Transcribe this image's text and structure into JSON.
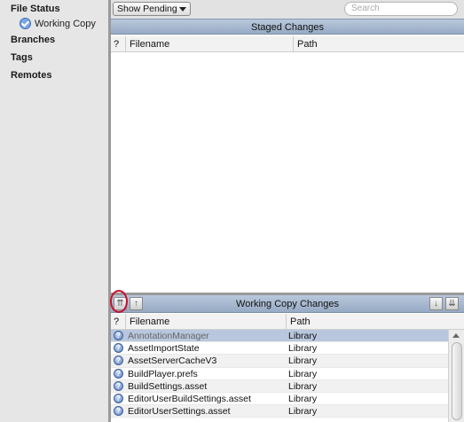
{
  "sidebar": {
    "file_status": "File Status",
    "working_copy": "Working Copy",
    "branches": "Branches",
    "tags": "Tags",
    "remotes": "Remotes"
  },
  "toolbar": {
    "filter_value": "Show Pending",
    "search_placeholder": "Search"
  },
  "staged": {
    "title": "Staged Changes",
    "col_status": "?",
    "col_filename": "Filename",
    "col_path": "Path"
  },
  "working": {
    "title": "Working Copy Changes",
    "col_status": "?",
    "col_filename": "Filename",
    "col_path": "Path",
    "rows": [
      {
        "filename": "AnnotationManager",
        "path": "Library"
      },
      {
        "filename": "AssetImportState",
        "path": "Library"
      },
      {
        "filename": "AssetServerCacheV3",
        "path": "Library"
      },
      {
        "filename": "BuildPlayer.prefs",
        "path": "Library"
      },
      {
        "filename": "BuildSettings.asset",
        "path": "Library"
      },
      {
        "filename": "EditorUserBuildSettings.asset",
        "path": "Library"
      },
      {
        "filename": "EditorUserSettings.asset",
        "path": "Library"
      }
    ]
  },
  "icons": {
    "status": "question-icon",
    "stage_all": "stage-all-icon",
    "stage_selected": "stage-selected-icon",
    "unstage_selected": "down-arrow-icon",
    "unstage_all": "double-down-arrow-icon"
  },
  "colors": {
    "header_blue": "#a8b9d1",
    "selection": "#b8c7dd",
    "highlight_ring": "#c8102e"
  }
}
